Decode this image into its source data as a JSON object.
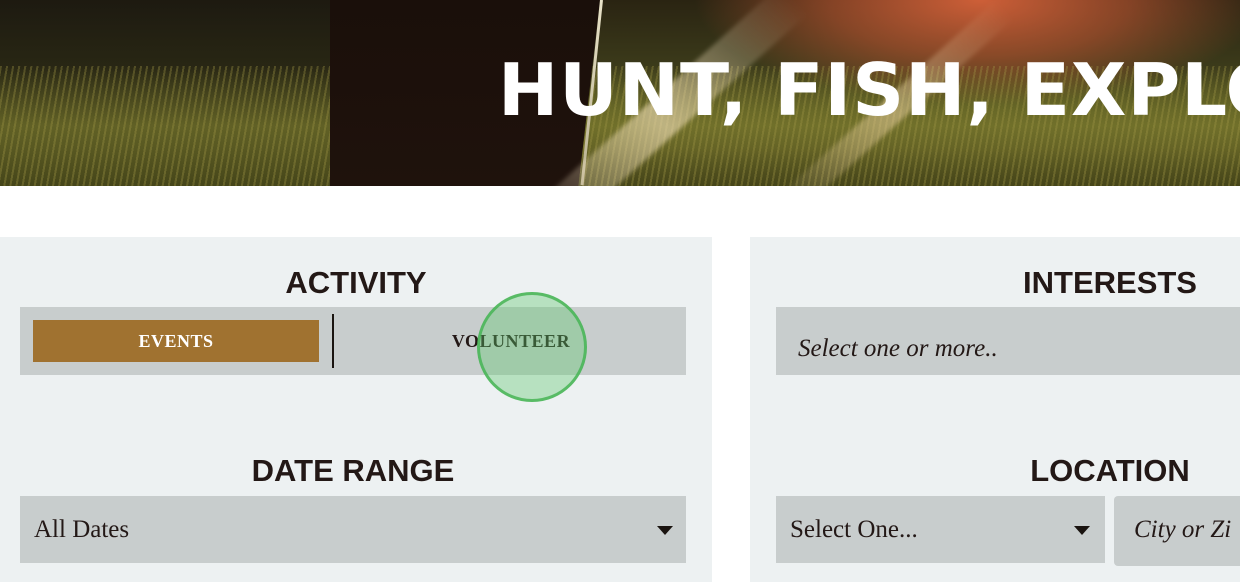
{
  "hero": {
    "title": "HUNT, FISH, EXPLO"
  },
  "activity": {
    "title": "ACTIVITY",
    "options": [
      {
        "label": "EVENTS",
        "selected": true
      },
      {
        "label": "VOLUNTEER",
        "selected": false
      }
    ]
  },
  "date_range": {
    "title": "DATE RANGE",
    "value": "All Dates"
  },
  "interests": {
    "title": "INTERESTS",
    "placeholder": "Select one or more.."
  },
  "location": {
    "title": "LOCATION",
    "select_value": "Select One...",
    "city_placeholder": "City or Zi"
  },
  "colors": {
    "accent": "#a07230",
    "panel_bg": "#edf1f2",
    "control_bg": "#c8cdcd",
    "text": "#231816"
  }
}
